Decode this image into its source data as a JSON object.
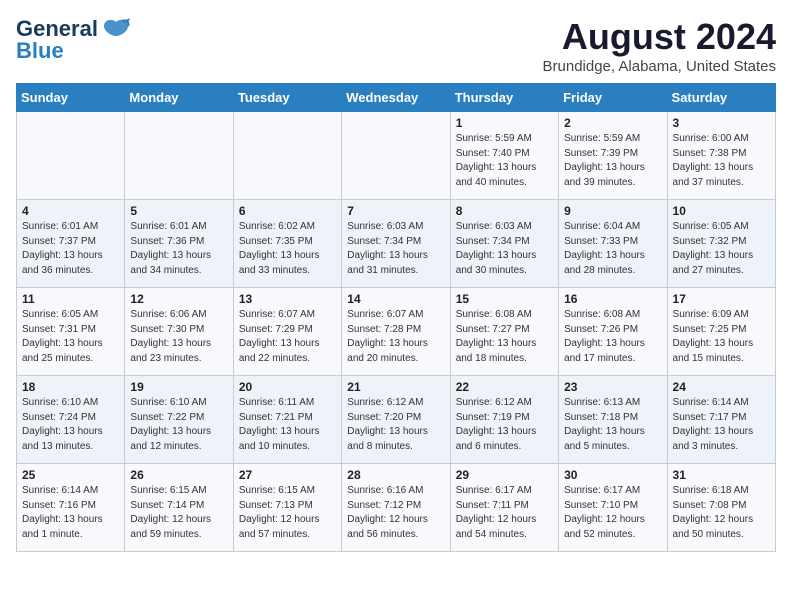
{
  "logo": {
    "line1": "General",
    "line2": "Blue"
  },
  "title": "August 2024",
  "subtitle": "Brundidge, Alabama, United States",
  "days_of_week": [
    "Sunday",
    "Monday",
    "Tuesday",
    "Wednesday",
    "Thursday",
    "Friday",
    "Saturday"
  ],
  "weeks": [
    [
      {
        "num": "",
        "info": ""
      },
      {
        "num": "",
        "info": ""
      },
      {
        "num": "",
        "info": ""
      },
      {
        "num": "",
        "info": ""
      },
      {
        "num": "1",
        "info": "Sunrise: 5:59 AM\nSunset: 7:40 PM\nDaylight: 13 hours\nand 40 minutes."
      },
      {
        "num": "2",
        "info": "Sunrise: 5:59 AM\nSunset: 7:39 PM\nDaylight: 13 hours\nand 39 minutes."
      },
      {
        "num": "3",
        "info": "Sunrise: 6:00 AM\nSunset: 7:38 PM\nDaylight: 13 hours\nand 37 minutes."
      }
    ],
    [
      {
        "num": "4",
        "info": "Sunrise: 6:01 AM\nSunset: 7:37 PM\nDaylight: 13 hours\nand 36 minutes."
      },
      {
        "num": "5",
        "info": "Sunrise: 6:01 AM\nSunset: 7:36 PM\nDaylight: 13 hours\nand 34 minutes."
      },
      {
        "num": "6",
        "info": "Sunrise: 6:02 AM\nSunset: 7:35 PM\nDaylight: 13 hours\nand 33 minutes."
      },
      {
        "num": "7",
        "info": "Sunrise: 6:03 AM\nSunset: 7:34 PM\nDaylight: 13 hours\nand 31 minutes."
      },
      {
        "num": "8",
        "info": "Sunrise: 6:03 AM\nSunset: 7:34 PM\nDaylight: 13 hours\nand 30 minutes."
      },
      {
        "num": "9",
        "info": "Sunrise: 6:04 AM\nSunset: 7:33 PM\nDaylight: 13 hours\nand 28 minutes."
      },
      {
        "num": "10",
        "info": "Sunrise: 6:05 AM\nSunset: 7:32 PM\nDaylight: 13 hours\nand 27 minutes."
      }
    ],
    [
      {
        "num": "11",
        "info": "Sunrise: 6:05 AM\nSunset: 7:31 PM\nDaylight: 13 hours\nand 25 minutes."
      },
      {
        "num": "12",
        "info": "Sunrise: 6:06 AM\nSunset: 7:30 PM\nDaylight: 13 hours\nand 23 minutes."
      },
      {
        "num": "13",
        "info": "Sunrise: 6:07 AM\nSunset: 7:29 PM\nDaylight: 13 hours\nand 22 minutes."
      },
      {
        "num": "14",
        "info": "Sunrise: 6:07 AM\nSunset: 7:28 PM\nDaylight: 13 hours\nand 20 minutes."
      },
      {
        "num": "15",
        "info": "Sunrise: 6:08 AM\nSunset: 7:27 PM\nDaylight: 13 hours\nand 18 minutes."
      },
      {
        "num": "16",
        "info": "Sunrise: 6:08 AM\nSunset: 7:26 PM\nDaylight: 13 hours\nand 17 minutes."
      },
      {
        "num": "17",
        "info": "Sunrise: 6:09 AM\nSunset: 7:25 PM\nDaylight: 13 hours\nand 15 minutes."
      }
    ],
    [
      {
        "num": "18",
        "info": "Sunrise: 6:10 AM\nSunset: 7:24 PM\nDaylight: 13 hours\nand 13 minutes."
      },
      {
        "num": "19",
        "info": "Sunrise: 6:10 AM\nSunset: 7:22 PM\nDaylight: 13 hours\nand 12 minutes."
      },
      {
        "num": "20",
        "info": "Sunrise: 6:11 AM\nSunset: 7:21 PM\nDaylight: 13 hours\nand 10 minutes."
      },
      {
        "num": "21",
        "info": "Sunrise: 6:12 AM\nSunset: 7:20 PM\nDaylight: 13 hours\nand 8 minutes."
      },
      {
        "num": "22",
        "info": "Sunrise: 6:12 AM\nSunset: 7:19 PM\nDaylight: 13 hours\nand 6 minutes."
      },
      {
        "num": "23",
        "info": "Sunrise: 6:13 AM\nSunset: 7:18 PM\nDaylight: 13 hours\nand 5 minutes."
      },
      {
        "num": "24",
        "info": "Sunrise: 6:14 AM\nSunset: 7:17 PM\nDaylight: 13 hours\nand 3 minutes."
      }
    ],
    [
      {
        "num": "25",
        "info": "Sunrise: 6:14 AM\nSunset: 7:16 PM\nDaylight: 13 hours\nand 1 minute."
      },
      {
        "num": "26",
        "info": "Sunrise: 6:15 AM\nSunset: 7:14 PM\nDaylight: 12 hours\nand 59 minutes."
      },
      {
        "num": "27",
        "info": "Sunrise: 6:15 AM\nSunset: 7:13 PM\nDaylight: 12 hours\nand 57 minutes."
      },
      {
        "num": "28",
        "info": "Sunrise: 6:16 AM\nSunset: 7:12 PM\nDaylight: 12 hours\nand 56 minutes."
      },
      {
        "num": "29",
        "info": "Sunrise: 6:17 AM\nSunset: 7:11 PM\nDaylight: 12 hours\nand 54 minutes."
      },
      {
        "num": "30",
        "info": "Sunrise: 6:17 AM\nSunset: 7:10 PM\nDaylight: 12 hours\nand 52 minutes."
      },
      {
        "num": "31",
        "info": "Sunrise: 6:18 AM\nSunset: 7:08 PM\nDaylight: 12 hours\nand 50 minutes."
      }
    ]
  ]
}
